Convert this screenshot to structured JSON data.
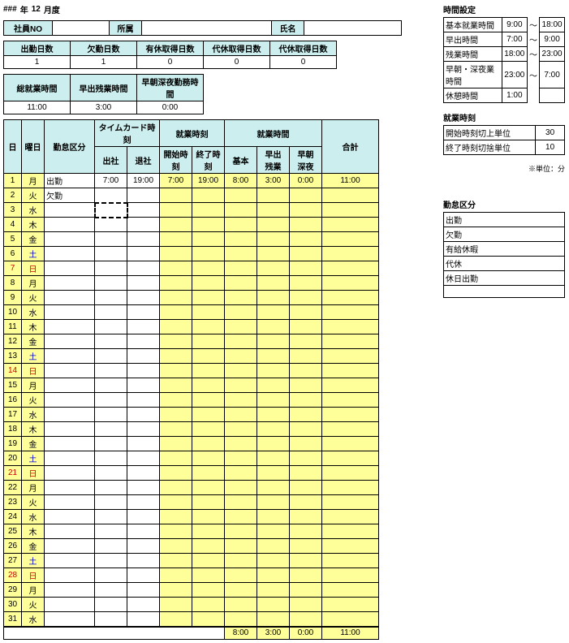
{
  "title": {
    "prefix": "###",
    "yearLabel": "年",
    "month": "12",
    "monthLabel": "月度"
  },
  "employee": {
    "idLabel": "社員NO",
    "idValue": "",
    "deptLabel": "所属",
    "deptValue": "",
    "nameLabel": "氏名",
    "nameValue": ""
  },
  "summaryTop": {
    "headers": [
      "出勤日数",
      "欠勤日数",
      "有休取得日数",
      "代休取得日数",
      "代休取得日数"
    ],
    "values": [
      "1",
      "1",
      "0",
      "0",
      "0"
    ]
  },
  "summaryBottom": {
    "headers": [
      "総就業時間",
      "早出残業時間",
      "早朝深夜勤務時間"
    ],
    "values": [
      "11:00",
      "3:00",
      "0:00"
    ]
  },
  "mainHeaders": {
    "day": "日",
    "dow": "曜日",
    "kubun": "勤怠区分",
    "timecard": "タイムカード時刻",
    "arrive": "出社",
    "leave": "退社",
    "worktime": "就業時刻",
    "start": "開始時刻",
    "end": "終了時刻",
    "workhours": "就業時間",
    "basic": "基本",
    "hayade": "早出\n残業",
    "soucho": "早朝\n深夜",
    "total": "合計"
  },
  "days": [
    {
      "d": "1",
      "w": "月",
      "wc": "",
      "k": "出勤",
      "tc1": "7:00",
      "tc2": "19:00",
      "s": "7:00",
      "e": "19:00",
      "b": "8:00",
      "h": "3:00",
      "n": "0:00",
      "t": "11:00"
    },
    {
      "d": "2",
      "w": "火",
      "wc": "",
      "k": "欠勤",
      "tc1": "",
      "tc2": "",
      "s": "",
      "e": "",
      "b": "",
      "h": "",
      "n": "",
      "t": ""
    },
    {
      "d": "3",
      "w": "水",
      "wc": "",
      "k": "",
      "tc1": "",
      "tc2": "",
      "s": "",
      "e": "",
      "b": "",
      "h": "",
      "n": "",
      "t": "",
      "cursor": true
    },
    {
      "d": "4",
      "w": "木",
      "wc": "",
      "k": "",
      "tc1": "",
      "tc2": "",
      "s": "",
      "e": "",
      "b": "",
      "h": "",
      "n": "",
      "t": ""
    },
    {
      "d": "5",
      "w": "金",
      "wc": "",
      "k": "",
      "tc1": "",
      "tc2": "",
      "s": "",
      "e": "",
      "b": "",
      "h": "",
      "n": "",
      "t": ""
    },
    {
      "d": "6",
      "w": "土",
      "wc": "blue",
      "k": "",
      "tc1": "",
      "tc2": "",
      "s": "",
      "e": "",
      "b": "",
      "h": "",
      "n": "",
      "t": ""
    },
    {
      "d": "7",
      "w": "日",
      "wc": "red",
      "k": "",
      "tc1": "",
      "tc2": "",
      "s": "",
      "e": "",
      "b": "",
      "h": "",
      "n": "",
      "t": ""
    },
    {
      "d": "8",
      "w": "月",
      "wc": "",
      "k": "",
      "tc1": "",
      "tc2": "",
      "s": "",
      "e": "",
      "b": "",
      "h": "",
      "n": "",
      "t": ""
    },
    {
      "d": "9",
      "w": "火",
      "wc": "",
      "k": "",
      "tc1": "",
      "tc2": "",
      "s": "",
      "e": "",
      "b": "",
      "h": "",
      "n": "",
      "t": ""
    },
    {
      "d": "10",
      "w": "水",
      "wc": "",
      "k": "",
      "tc1": "",
      "tc2": "",
      "s": "",
      "e": "",
      "b": "",
      "h": "",
      "n": "",
      "t": ""
    },
    {
      "d": "11",
      "w": "木",
      "wc": "",
      "k": "",
      "tc1": "",
      "tc2": "",
      "s": "",
      "e": "",
      "b": "",
      "h": "",
      "n": "",
      "t": ""
    },
    {
      "d": "12",
      "w": "金",
      "wc": "",
      "k": "",
      "tc1": "",
      "tc2": "",
      "s": "",
      "e": "",
      "b": "",
      "h": "",
      "n": "",
      "t": ""
    },
    {
      "d": "13",
      "w": "土",
      "wc": "blue",
      "k": "",
      "tc1": "",
      "tc2": "",
      "s": "",
      "e": "",
      "b": "",
      "h": "",
      "n": "",
      "t": ""
    },
    {
      "d": "14",
      "w": "日",
      "wc": "red",
      "k": "",
      "tc1": "",
      "tc2": "",
      "s": "",
      "e": "",
      "b": "",
      "h": "",
      "n": "",
      "t": ""
    },
    {
      "d": "15",
      "w": "月",
      "wc": "",
      "k": "",
      "tc1": "",
      "tc2": "",
      "s": "",
      "e": "",
      "b": "",
      "h": "",
      "n": "",
      "t": ""
    },
    {
      "d": "16",
      "w": "火",
      "wc": "",
      "k": "",
      "tc1": "",
      "tc2": "",
      "s": "",
      "e": "",
      "b": "",
      "h": "",
      "n": "",
      "t": ""
    },
    {
      "d": "17",
      "w": "水",
      "wc": "",
      "k": "",
      "tc1": "",
      "tc2": "",
      "s": "",
      "e": "",
      "b": "",
      "h": "",
      "n": "",
      "t": ""
    },
    {
      "d": "18",
      "w": "木",
      "wc": "",
      "k": "",
      "tc1": "",
      "tc2": "",
      "s": "",
      "e": "",
      "b": "",
      "h": "",
      "n": "",
      "t": ""
    },
    {
      "d": "19",
      "w": "金",
      "wc": "",
      "k": "",
      "tc1": "",
      "tc2": "",
      "s": "",
      "e": "",
      "b": "",
      "h": "",
      "n": "",
      "t": ""
    },
    {
      "d": "20",
      "w": "土",
      "wc": "blue",
      "k": "",
      "tc1": "",
      "tc2": "",
      "s": "",
      "e": "",
      "b": "",
      "h": "",
      "n": "",
      "t": ""
    },
    {
      "d": "21",
      "w": "日",
      "wc": "red",
      "k": "",
      "tc1": "",
      "tc2": "",
      "s": "",
      "e": "",
      "b": "",
      "h": "",
      "n": "",
      "t": ""
    },
    {
      "d": "22",
      "w": "月",
      "wc": "",
      "k": "",
      "tc1": "",
      "tc2": "",
      "s": "",
      "e": "",
      "b": "",
      "h": "",
      "n": "",
      "t": ""
    },
    {
      "d": "23",
      "w": "火",
      "wc": "",
      "k": "",
      "tc1": "",
      "tc2": "",
      "s": "",
      "e": "",
      "b": "",
      "h": "",
      "n": "",
      "t": ""
    },
    {
      "d": "24",
      "w": "水",
      "wc": "",
      "k": "",
      "tc1": "",
      "tc2": "",
      "s": "",
      "e": "",
      "b": "",
      "h": "",
      "n": "",
      "t": ""
    },
    {
      "d": "25",
      "w": "木",
      "wc": "",
      "k": "",
      "tc1": "",
      "tc2": "",
      "s": "",
      "e": "",
      "b": "",
      "h": "",
      "n": "",
      "t": ""
    },
    {
      "d": "26",
      "w": "金",
      "wc": "",
      "k": "",
      "tc1": "",
      "tc2": "",
      "s": "",
      "e": "",
      "b": "",
      "h": "",
      "n": "",
      "t": ""
    },
    {
      "d": "27",
      "w": "土",
      "wc": "blue",
      "k": "",
      "tc1": "",
      "tc2": "",
      "s": "",
      "e": "",
      "b": "",
      "h": "",
      "n": "",
      "t": ""
    },
    {
      "d": "28",
      "w": "日",
      "wc": "red",
      "k": "",
      "tc1": "",
      "tc2": "",
      "s": "",
      "e": "",
      "b": "",
      "h": "",
      "n": "",
      "t": ""
    },
    {
      "d": "29",
      "w": "月",
      "wc": "",
      "k": "",
      "tc1": "",
      "tc2": "",
      "s": "",
      "e": "",
      "b": "",
      "h": "",
      "n": "",
      "t": ""
    },
    {
      "d": "30",
      "w": "火",
      "wc": "",
      "k": "",
      "tc1": "",
      "tc2": "",
      "s": "",
      "e": "",
      "b": "",
      "h": "",
      "n": "",
      "t": ""
    },
    {
      "d": "31",
      "w": "水",
      "wc": "",
      "k": "",
      "tc1": "",
      "tc2": "",
      "s": "",
      "e": "",
      "b": "",
      "h": "",
      "n": "",
      "t": ""
    }
  ],
  "totals": {
    "b": "8:00",
    "h": "3:00",
    "n": "0:00",
    "t": "11:00"
  },
  "timeSettings": {
    "title": "時間設定",
    "rows": [
      {
        "label": "基本就業時間",
        "from": "9:00",
        "sep": "～",
        "to": "18:00"
      },
      {
        "label": "早出時間",
        "from": "7:00",
        "sep": "～",
        "to": "9:00"
      },
      {
        "label": "残業時間",
        "from": "18:00",
        "sep": "～",
        "to": "23:00"
      },
      {
        "label": "早朝・深夜業時間",
        "from": "23:00",
        "sep": "～",
        "to": "7:00"
      },
      {
        "label": "休憩時間",
        "from": "1:00",
        "sep": "",
        "to": ""
      }
    ]
  },
  "workRules": {
    "title": "就業時刻",
    "rows": [
      {
        "label": "開始時刻切上単位",
        "val": "30"
      },
      {
        "label": "終了時刻切捨単位",
        "val": "10"
      }
    ],
    "note": "※単位：分"
  },
  "kubunList": {
    "title": "勤怠区分",
    "items": [
      "出勤",
      "欠勤",
      "有給休暇",
      "代休",
      "休日出勤",
      ""
    ]
  }
}
